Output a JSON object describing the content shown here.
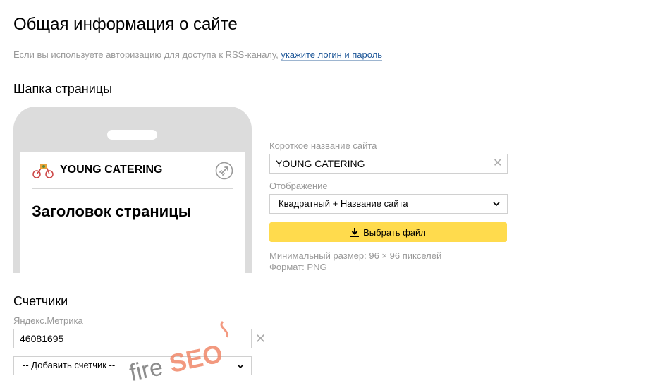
{
  "page": {
    "title": "Общая информация о сайте",
    "hint_text": "Если вы используете авторизацию для доступа к RSS-каналу, ",
    "hint_link": "укажите логин и пароль"
  },
  "header_section": {
    "title": "Шапка страницы",
    "preview": {
      "site_name": "YOUNG CATERING",
      "page_heading": "Заголовок страницы"
    },
    "short_name": {
      "label": "Короткое название сайта",
      "value": "YOUNG CATERING",
      "clear_glyph": "✕"
    },
    "display": {
      "label": "Отображение",
      "selected": "Квадратный + Название сайта"
    },
    "upload_button": "Выбрать файл",
    "note_size": "Минимальный размер: 96 × 96 пикселей",
    "note_format": "Формат: PNG"
  },
  "counters_section": {
    "title": "Счетчики",
    "metrika_label": "Яндекс.Метрика",
    "metrika_value": "46081695",
    "clear_glyph": "✕",
    "add_counter": "-- Добавить счетчик --"
  },
  "watermark": {
    "text_dark": "fire",
    "text_accent": "SEO",
    "color_dark": "#666666",
    "color_accent": "#f08060"
  },
  "colors": {
    "accent_yellow": "#ffdb4d",
    "link": "#1a5496",
    "muted": "#999999"
  }
}
